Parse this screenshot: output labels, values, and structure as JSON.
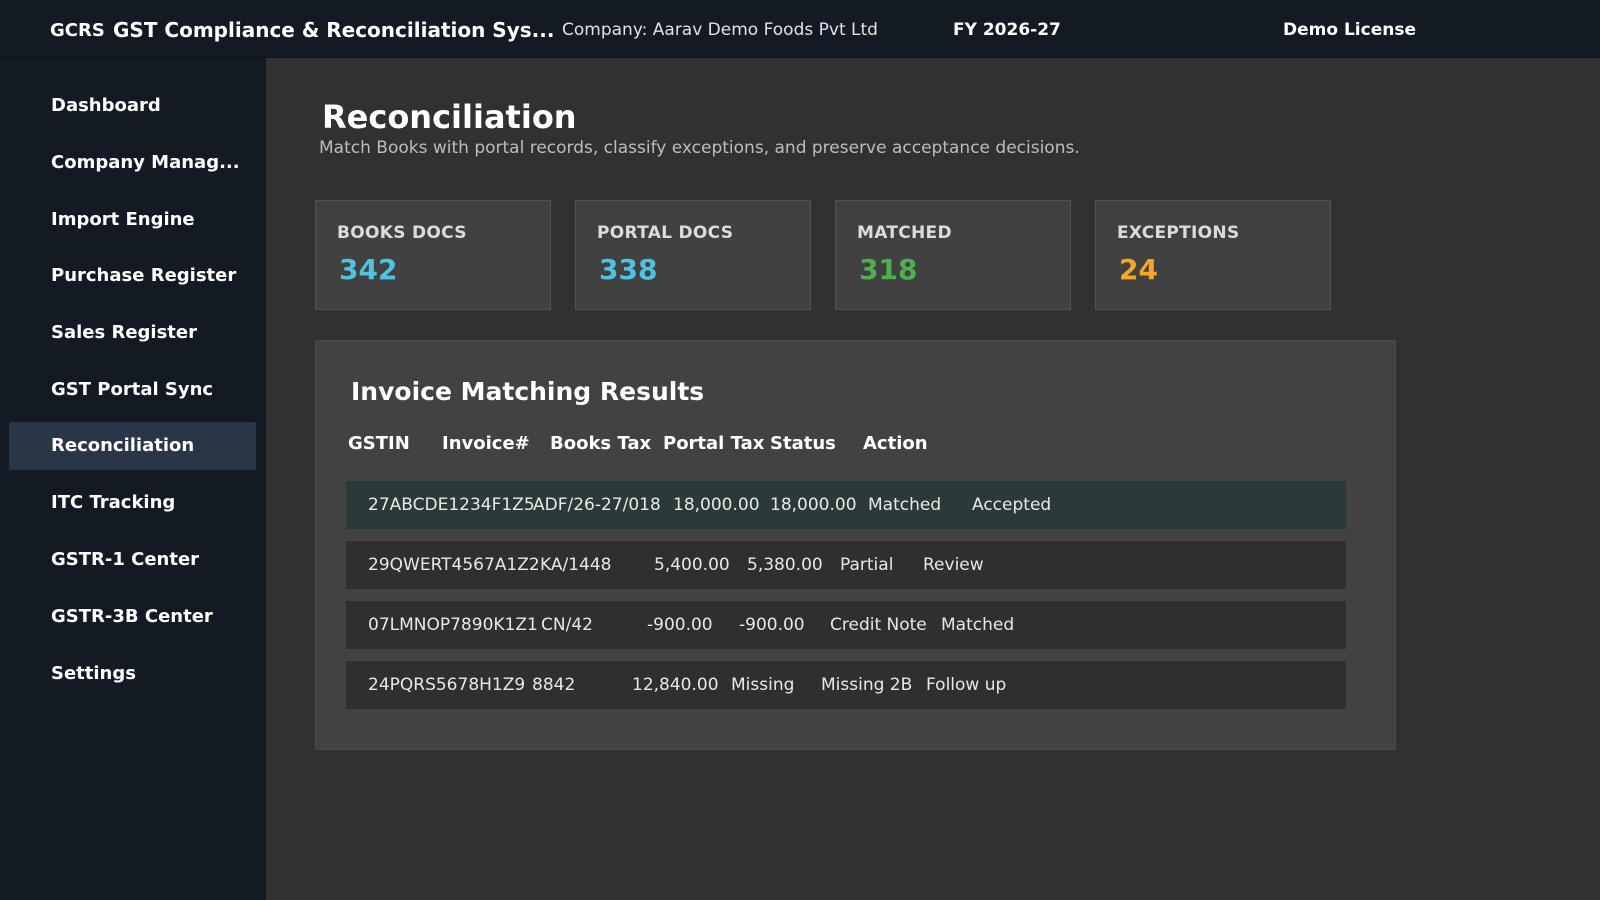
{
  "topbar": {
    "brand_abbr": "GCRS",
    "brand_title": "GST Compliance & Reconciliation Sys...",
    "company": "Company: Aarav Demo Foods Pvt Ltd",
    "fy": "FY 2026-27",
    "license": "Demo License"
  },
  "sidebar": {
    "items": [
      {
        "label": "Dashboard"
      },
      {
        "label": "Company Manag..."
      },
      {
        "label": "Import Engine"
      },
      {
        "label": "Purchase Register"
      },
      {
        "label": "Sales Register"
      },
      {
        "label": "GST Portal Sync"
      },
      {
        "label": "Reconciliation"
      },
      {
        "label": "ITC Tracking"
      },
      {
        "label": "GSTR-1 Center"
      },
      {
        "label": "GSTR-3B Center"
      },
      {
        "label": "Settings"
      }
    ],
    "active_index": 6
  },
  "page": {
    "title": "Reconciliation",
    "subtitle": "Match Books with portal records, classify exceptions, and preserve acceptance decisions."
  },
  "stats": [
    {
      "label": "BOOKS DOCS",
      "value": "342",
      "color": "#4ec3e0"
    },
    {
      "label": "PORTAL DOCS",
      "value": "338",
      "color": "#4ec3e0"
    },
    {
      "label": "MATCHED",
      "value": "318",
      "color": "#4caf50"
    },
    {
      "label": "EXCEPTIONS",
      "value": "24",
      "color": "#f5a623"
    }
  ],
  "results": {
    "title": "Invoice Matching Results",
    "columns": [
      "GSTIN",
      "Invoice#",
      "Books Tax",
      "Portal Tax",
      "Status",
      "Action"
    ],
    "rows": [
      {
        "gstin": "27ABCDE1234F1Z5",
        "invoice": "ADF/26-27/018",
        "books_tax": "18,000.00",
        "portal_tax": "18,000.00",
        "status": "Matched",
        "action": "Accepted"
      },
      {
        "gstin": "29QWERT4567A1Z2",
        "invoice": "KA/1448",
        "books_tax": "5,400.00",
        "portal_tax": "5,380.00",
        "status": "Partial",
        "action": "Review"
      },
      {
        "gstin": "07LMNOP7890K1Z1",
        "invoice": "CN/42",
        "books_tax": "-900.00",
        "portal_tax": "-900.00",
        "status": "Credit Note",
        "action": "Matched"
      },
      {
        "gstin": "24PQRS5678H1Z9",
        "invoice": "8842",
        "books_tax": "12,840.00",
        "portal_tax": "Missing",
        "status": "Missing 2B",
        "action": "Follow up"
      }
    ]
  }
}
